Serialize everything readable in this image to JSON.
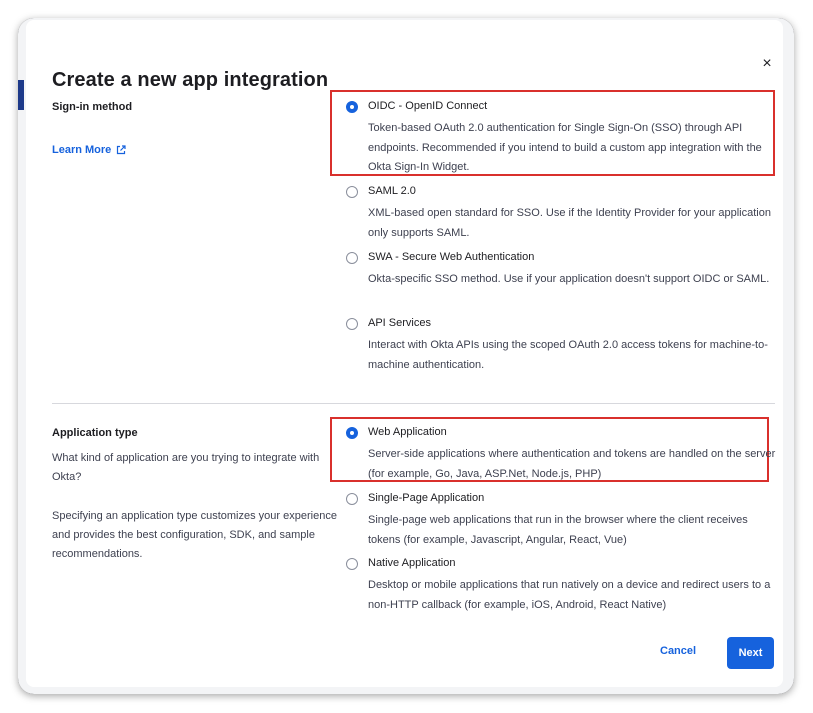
{
  "dialog": {
    "title": "Create a new app integration",
    "close_label": "×"
  },
  "signin": {
    "heading": "Sign-in method",
    "learn_more": "Learn More",
    "options": [
      {
        "title": "OIDC - OpenID Connect",
        "desc": "Token-based OAuth 2.0 authentication for Single Sign-On (SSO) through API endpoints. Recommended if you intend to build a custom app integration with the Okta Sign-In Widget.",
        "selected": true
      },
      {
        "title": "SAML 2.0",
        "desc": "XML-based open standard for SSO. Use if the Identity Provider for your application only supports SAML.",
        "selected": false
      },
      {
        "title": "SWA - Secure Web Authentication",
        "desc": "Okta-specific SSO method. Use if your application doesn't support OIDC or SAML.",
        "selected": false
      },
      {
        "title": "API Services",
        "desc": "Interact with Okta APIs using the scoped OAuth 2.0 access tokens for machine-to-machine authentication.",
        "selected": false
      }
    ]
  },
  "apptype": {
    "heading": "Application type",
    "question": "What kind of application are you trying to integrate with Okta?",
    "hint": "Specifying an application type customizes your experience and provides the best configuration, SDK, and sample recommendations.",
    "options": [
      {
        "title": "Web Application",
        "desc": "Server-side applications where authentication and tokens are handled on the server (for example, Go, Java, ASP.Net, Node.js, PHP)",
        "selected": true
      },
      {
        "title": "Single-Page Application",
        "desc": "Single-page web applications that run in the browser where the client receives tokens (for example, Javascript, Angular, React, Vue)",
        "selected": false
      },
      {
        "title": "Native Application",
        "desc": "Desktop or mobile applications that run natively on a device and redirect users to a non-HTTP callback (for example, iOS, Android, React Native)",
        "selected": false
      }
    ]
  },
  "footer": {
    "cancel_label": "Cancel",
    "next_label": "Next"
  },
  "colors": {
    "accent": "#1662dd",
    "highlight": "#d9302c"
  }
}
